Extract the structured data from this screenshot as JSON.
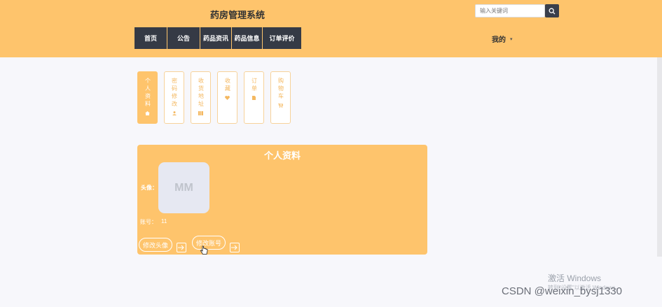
{
  "header": {
    "site_title": "药房管理系统",
    "search": {
      "placeholder": "输入关键词"
    },
    "nav": [
      {
        "label": "首页"
      },
      {
        "label": "公告"
      },
      {
        "label": "药品资讯"
      },
      {
        "label": "药品信息"
      },
      {
        "label": "订单评价"
      }
    ],
    "user_menu": {
      "label": "我的"
    }
  },
  "sidebar": {
    "tabs": [
      {
        "label": "个人资料",
        "icon": "home-icon",
        "active": true
      },
      {
        "label": "密码修改",
        "icon": "user-icon",
        "active": false
      },
      {
        "label": "收货地址",
        "icon": "address-icon",
        "active": false
      },
      {
        "label": "收藏",
        "icon": "heart-icon",
        "active": false
      },
      {
        "label": "订单",
        "icon": "file-icon",
        "active": false
      },
      {
        "label": "购物车",
        "icon": "cart-icon",
        "active": false
      }
    ]
  },
  "profile": {
    "title": "个人资料",
    "avatar_label": "头像：",
    "avatar_text": "MM",
    "account_label": "账号：",
    "account_value": "11",
    "change_avatar_button": "修改头像",
    "change_account_button": "修改账号"
  },
  "overlay": {
    "activate_windows": "激活 Windows",
    "activate_hint": "转到\"设置\"以激活 Windows。",
    "csdn_watermark": "CSDN @weixin_bysj1330"
  },
  "colors": {
    "primary": "#fec46c",
    "nav_bg": "#353a45",
    "page_bg": "#f7f7fb"
  }
}
